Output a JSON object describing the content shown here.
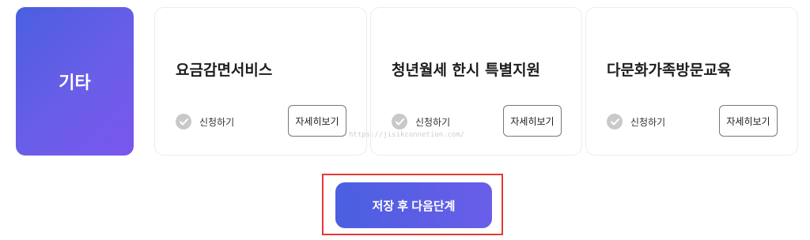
{
  "category": {
    "label": "기타"
  },
  "services": [
    {
      "title": "요금감면서비스",
      "apply_label": "신청하기",
      "detail_label": "자세히보기",
      "status_icon": "check-circle-icon"
    },
    {
      "title": "청년월세 한시 특별지원",
      "apply_label": "신청하기",
      "detail_label": "자세히보기",
      "status_icon": "check-circle-icon"
    },
    {
      "title": "다문화가족방문교육",
      "apply_label": "신청하기",
      "detail_label": "자세히보기",
      "status_icon": "check-circle-icon"
    }
  ],
  "watermark": "https://jisikconnetion.com/",
  "footer": {
    "next_button_label": "저장 후 다음단계"
  },
  "colors": {
    "accent_start": "#4a5fe0",
    "accent_end": "#7a56ee",
    "check_gray": "#c9c9c9",
    "highlight_red": "#e53935"
  }
}
